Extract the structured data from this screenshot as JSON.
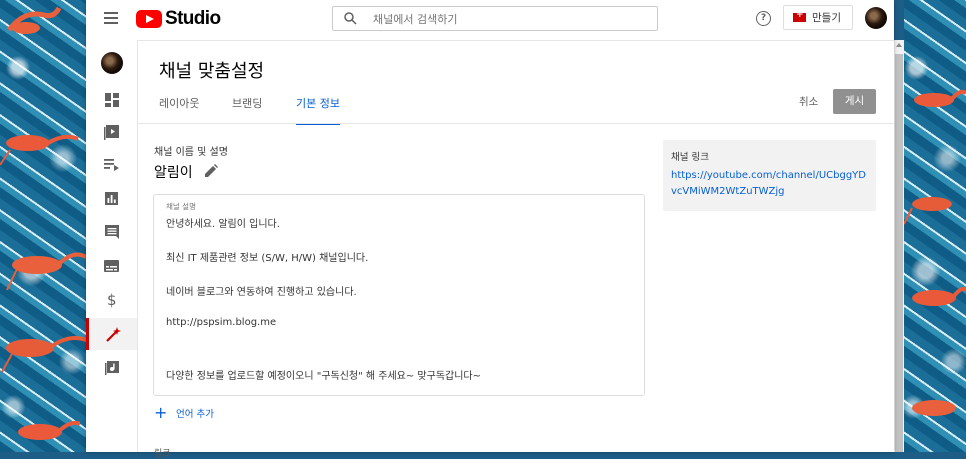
{
  "header": {
    "logo_text": "Studio",
    "search_placeholder": "채널에서 검색하기",
    "help_glyph": "?",
    "create_label": "만들기"
  },
  "page": {
    "title": "채널 맞춤설정",
    "tabs": [
      {
        "label": "레이아웃",
        "active": false
      },
      {
        "label": "브랜딩",
        "active": false
      },
      {
        "label": "기본 정보",
        "active": true
      }
    ],
    "cancel_label": "취소",
    "publish_label": "게시"
  },
  "basic_info": {
    "section_label": "채널 이름 및 설명",
    "channel_name": "알림이",
    "description_label": "채널 설명",
    "description_lines": [
      "안녕하세요. 알림이 입니다.",
      "최신 IT 제품관련 정보 (S/W, H/W) 채널입니다.",
      "네이버 블로그와 연동하여 진행하고 있습니다.",
      "http://pspsim.blog.me",
      "다양한 정보를 업로드할 예정이오니 \"구독신청\"  해 주세요~ 맞구독갑니다~"
    ],
    "add_language_label": "언어 추가",
    "next_section_partial": "링크"
  },
  "channel_link": {
    "title": "채널 링크",
    "url": "https://youtube.com/channel/UCbggYDvcVMiWM2WtZuTWZjg"
  },
  "sidebar_icons": [
    "dashboard-icon",
    "content-icon",
    "playlists-icon",
    "analytics-icon",
    "comments-icon",
    "subtitles-icon",
    "monetization-icon",
    "customization-icon",
    "audio-library-icon"
  ],
  "colors": {
    "accent_blue": "#065fd4",
    "youtube_red": "#ff0000",
    "active_nav_red": "#cc0000",
    "publish_disabled": "#909090"
  }
}
